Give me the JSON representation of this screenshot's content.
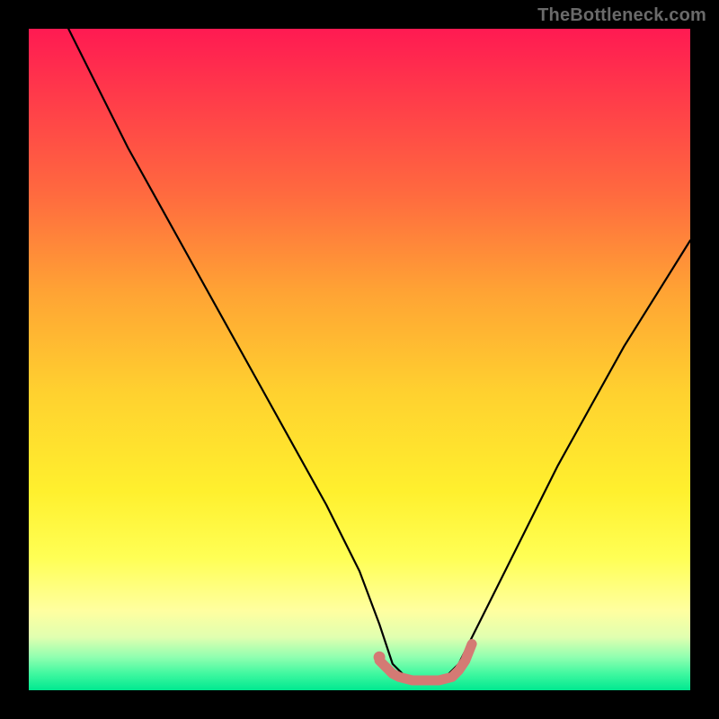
{
  "attribution": "TheBottleneck.com",
  "chart_data": {
    "type": "line",
    "title": "",
    "xlabel": "",
    "ylabel": "",
    "xlim": [
      0,
      100
    ],
    "ylim": [
      0,
      100
    ],
    "grid": false,
    "legend": false,
    "series": [
      {
        "name": "bottleneck-curve",
        "color": "#000000",
        "x": [
          6,
          10,
          15,
          20,
          25,
          30,
          35,
          40,
          45,
          50,
          53,
          55,
          58,
          62,
          65,
          67,
          70,
          75,
          80,
          85,
          90,
          95,
          100
        ],
        "values": [
          100,
          92,
          82,
          73,
          64,
          55,
          46,
          37,
          28,
          18,
          10,
          4,
          1,
          1,
          4,
          8,
          14,
          24,
          34,
          43,
          52,
          60,
          68
        ]
      },
      {
        "name": "optimal-range-marker",
        "color": "#d47a74",
        "x": [
          53,
          55,
          56,
          58,
          60,
          62,
          64,
          65,
          66,
          67
        ],
        "values": [
          4.5,
          2.5,
          2.0,
          1.5,
          1.5,
          1.5,
          2.0,
          3.0,
          4.5,
          7.0
        ]
      }
    ],
    "markers": [
      {
        "name": "optimal-start-dot",
        "x": 53,
        "y": 5,
        "color": "#d47a74"
      }
    ],
    "background": {
      "type": "vertical-gradient",
      "stops": [
        {
          "pos": 0.0,
          "color": "#ff1a52"
        },
        {
          "pos": 0.25,
          "color": "#ff6a3f"
        },
        {
          "pos": 0.55,
          "color": "#ffd12f"
        },
        {
          "pos": 0.8,
          "color": "#ffff55"
        },
        {
          "pos": 0.92,
          "color": "#e0ffb0"
        },
        {
          "pos": 1.0,
          "color": "#00e890"
        }
      ]
    }
  }
}
